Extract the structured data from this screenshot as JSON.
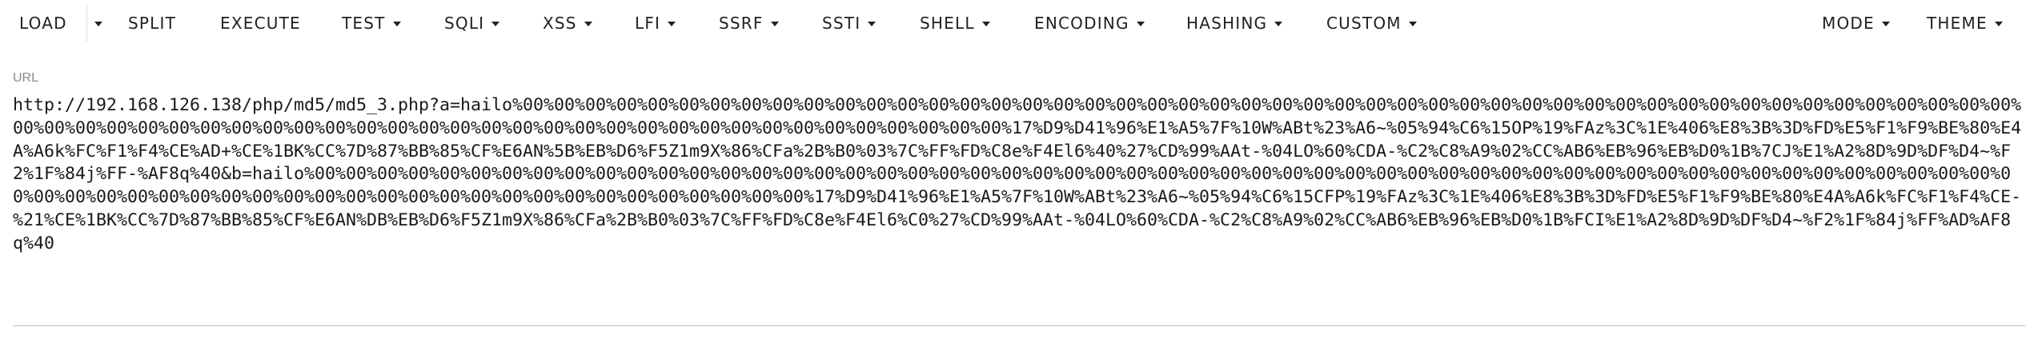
{
  "toolbar": {
    "left": [
      {
        "label": "LOAD",
        "dropdown": false
      },
      {
        "label": "SPLIT",
        "dropdown": false
      },
      {
        "label": "EXECUTE",
        "dropdown": false
      },
      {
        "label": "TEST",
        "dropdown": true
      },
      {
        "label": "SQLI",
        "dropdown": true
      },
      {
        "label": "XSS",
        "dropdown": true
      },
      {
        "label": "LFI",
        "dropdown": true
      },
      {
        "label": "SSRF",
        "dropdown": true
      },
      {
        "label": "SSTI",
        "dropdown": true
      },
      {
        "label": "SHELL",
        "dropdown": true
      },
      {
        "label": "ENCODING",
        "dropdown": true
      },
      {
        "label": "HASHING",
        "dropdown": true
      },
      {
        "label": "CUSTOM",
        "dropdown": true
      }
    ],
    "right": [
      {
        "label": "MODE",
        "dropdown": true
      },
      {
        "label": "THEME",
        "dropdown": true
      }
    ],
    "load_menu_icon": "chevron-down-icon"
  },
  "url_section": {
    "label": "URL",
    "value": "http://192.168.126.138/php/md5/md5_3.php?a=hailo%00%00%00%00%00%00%00%00%00%00%00%00%00%00%00%00%00%00%00%00%00%00%00%00%00%00%00%00%00%00%00%00%00%00%00%00%00%00%00%00%00%00%00%00%00%00%00%00%00%00%00%00%00%00%00%00%00%00%00%00%00%00%00%00%00%00%00%00%00%00%00%00%00%00%00%00%00%00%00%00%17%D9%D41%96%E1%A5%7F%10W%ABt%23%A6~%05%94%C6%15OP%19%FAz%3C%1E%406%E8%3B%3D%FD%E5%F1%F9%BE%80%E4A%A6k%FC%F1%F4%CE%AD+%CE%1BK%CC%7D%87%BB%85%CF%E6AN%5B%EB%D6%F5Z1m9X%86%CFa%2B%B0%03%7C%FF%FD%C8e%F4El6%40%27%CD%99%AAt-%04LO%60%CDA-%C2%C8%A9%02%CC%AB6%EB%96%EB%D0%1B%7CJ%E1%A2%8D%9D%DF%D4~%F2%1F%84j%FF-%AF8q%40&b=hailo%00%00%00%00%00%00%00%00%00%00%00%00%00%00%00%00%00%00%00%00%00%00%00%00%00%00%00%00%00%00%00%00%00%00%00%00%00%00%00%00%00%00%00%00%00%00%00%00%00%00%00%00%00%00%00%00%00%00%00%00%00%00%00%00%00%00%00%00%00%00%00%00%00%00%00%00%00%00%00%00%17%D9%D41%96%E1%A5%7F%10W%ABt%23%A6~%05%94%C6%15CFP%19%FAz%3C%1E%406%E8%3B%3D%FD%E5%F1%F9%BE%80%E4A%A6k%FC%F1%F4%CE-%21%CE%1BK%CC%7D%87%BB%85%CF%E6AN%DB%EB%D6%F5Z1m9X%86%CFa%2B%B0%03%7C%FF%FD%C8e%F4El6%C0%27%CD%99%AAt-%04LO%60%CDA-%C2%C8%A9%02%CC%AB6%EB%96%EB%D0%1B%FCI%E1%A2%8D%9D%DF%D4~%F2%1F%84j%FF%AD%AF8q%40"
  },
  "colors": {
    "text": "#212121",
    "label": "#8a8a8a",
    "divider": "#bdbdbd",
    "background": "#ffffff"
  }
}
